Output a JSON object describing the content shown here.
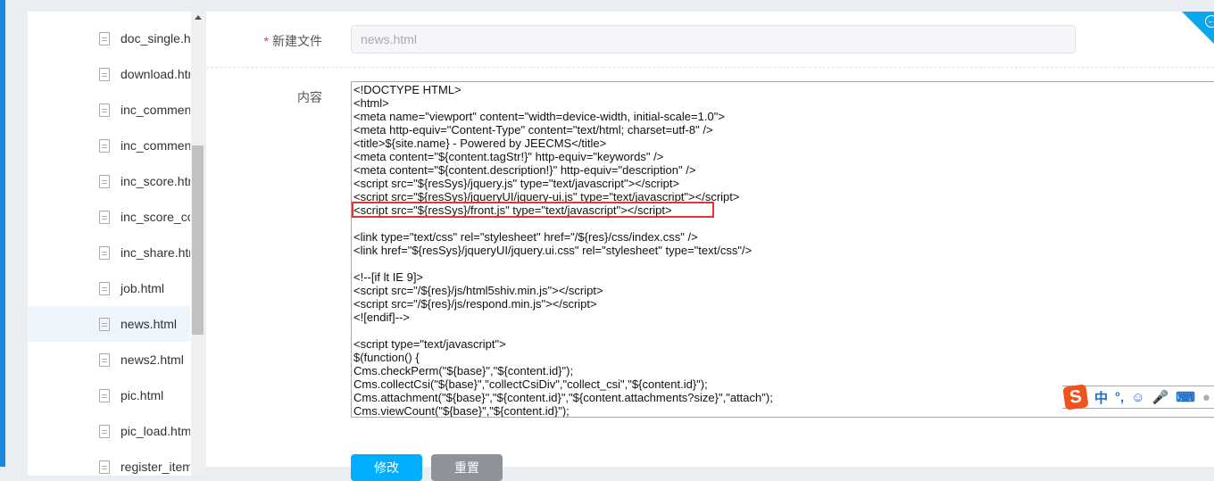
{
  "sidebar": {
    "files": [
      "doc_single.html",
      "download.html",
      "inc_comment.html",
      "inc_comment_list.html",
      "inc_score.html",
      "inc_score_content.html",
      "inc_share.html",
      "job.html",
      "news.html",
      "news2.html",
      "pic.html",
      "pic_load.html",
      "register_item.html"
    ],
    "active_index": 8,
    "scroll_fraction": 0.35
  },
  "form": {
    "required_mark": "*",
    "filename_label": "新建文件",
    "filename_placeholder": "news.html",
    "content_label": "内容",
    "content_lines": [
      "<!DOCTYPE HTML>",
      "<html>",
      "<meta name=\"viewport\" content=\"width=device-width, initial-scale=1.0\">",
      "<meta http-equiv=\"Content-Type\" content=\"text/html; charset=utf-8\" />",
      "<title>${site.name} - Powered by JEECMS</title>",
      "<meta content=\"${content.tagStr!}\" http-equiv=\"keywords\" />",
      "<meta content=\"${content.description!}\" http-equiv=\"description\" />",
      "<script src=\"${resSys}/jquery.js\" type=\"text/javascript\"></script>",
      "<script src=\"${resSys}/jqueryUI/jquery-ui.js\" type=\"text/javascript\"></script>",
      "<script src=\"${resSys}/front.js\" type=\"text/javascript\"></script>",
      "",
      "<link type=\"text/css\" rel=\"stylesheet\" href=\"/${res}/css/index.css\" />",
      "<link href=\"${resSys}/jqueryUI/jquery.ui.css\" rel=\"stylesheet\" type=\"text/css\"/>",
      "",
      "<!--[if lt IE 9]>",
      "<script src=\"/${res}/js/html5shiv.min.js\"></script>",
      "<script src=\"/${res}/js/respond.min.js\"></script>",
      "<![endif]-->",
      "",
      "<script type=\"text/javascript\">",
      "$(function() {",
      "Cms.checkPerm(\"${base}\",\"${content.id}\");",
      "Cms.collectCsi(\"${base}\",\"collectCsiDiv\",\"collect_csi\",\"${content.id}\");",
      "Cms.attachment(\"${base}\",\"${content.id}\",\"${content.attachments?size}\",\"attach\");",
      "Cms.viewCount(\"${base}\",\"${content.id}\");"
    ],
    "highlighted_line": 9,
    "submit_label": "修改",
    "reset_label": "重置"
  },
  "ime": {
    "logo": "S",
    "mode": "中",
    "punct": "°,"
  },
  "colors": {
    "primary": "#00aeff",
    "reset": "#8e9299",
    "highlight": "#e53333"
  }
}
